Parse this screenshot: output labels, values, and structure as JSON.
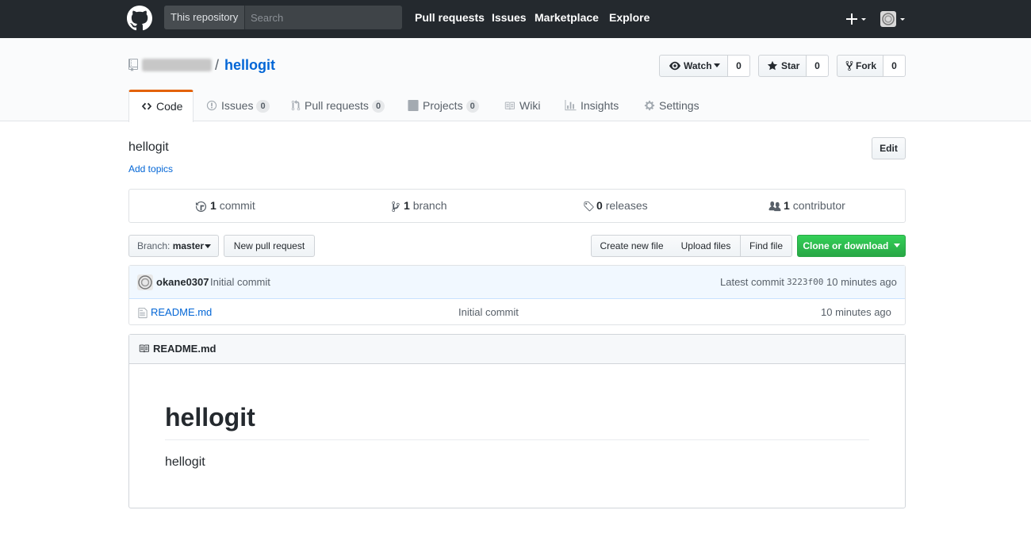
{
  "header": {
    "scope_label": "This repository",
    "search_placeholder": "Search",
    "nav": [
      "Pull requests",
      "Issues",
      "Marketplace",
      "Explore"
    ]
  },
  "repo": {
    "name": "hellogit",
    "separator": "/",
    "watch": {
      "label": "Watch",
      "count": "0"
    },
    "star": {
      "label": "Star",
      "count": "0"
    },
    "fork": {
      "label": "Fork",
      "count": "0"
    }
  },
  "tabs": [
    {
      "label": "Code",
      "icon": "code-icon",
      "selected": true
    },
    {
      "label": "Issues",
      "count": "0",
      "icon": "issue-icon"
    },
    {
      "label": "Pull requests",
      "count": "0",
      "icon": "pull-request-icon"
    },
    {
      "label": "Projects",
      "count": "0",
      "icon": "project-icon"
    },
    {
      "label": "Wiki",
      "icon": "book-icon"
    },
    {
      "label": "Insights",
      "icon": "graph-icon"
    },
    {
      "label": "Settings",
      "icon": "gear-icon"
    }
  ],
  "description": {
    "text": "hellogit",
    "add_topics": "Add topics",
    "edit_label": "Edit"
  },
  "summary": {
    "commits": {
      "count": "1",
      "label": "commit"
    },
    "branches": {
      "count": "1",
      "label": "branch"
    },
    "releases": {
      "count": "0",
      "label": "releases"
    },
    "contributors": {
      "count": "1",
      "label": "contributor"
    }
  },
  "file_nav": {
    "branch_prefix": "Branch:",
    "branch_name": "master",
    "new_pull_request": "New pull request",
    "create_new_file": "Create new file",
    "upload_files": "Upload files",
    "find_file": "Find file",
    "clone_or_download": "Clone or download"
  },
  "latest_commit": {
    "author": "okane0307",
    "message": "Initial commit",
    "prefix": "Latest commit",
    "sha": "3223f00",
    "age": "10 minutes ago"
  },
  "files": [
    {
      "name": "README.md",
      "message": "Initial commit",
      "age": "10 minutes ago",
      "icon": "file-icon"
    }
  ],
  "readme": {
    "filename": "README.md",
    "heading": "hellogit",
    "body": "hellogit"
  },
  "colors": {
    "header_bg": "#24292e",
    "link": "#0366d6",
    "tab_accent": "#e36209",
    "primary_button": "#28a745",
    "commit_tease_bg": "#f1f8ff"
  }
}
